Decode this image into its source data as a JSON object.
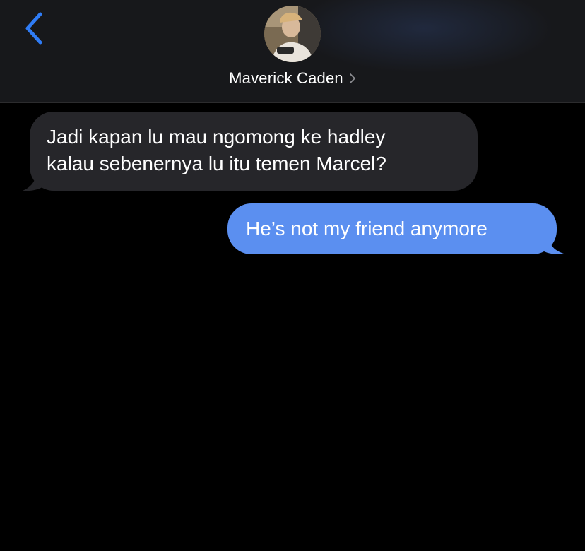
{
  "header": {
    "back_icon": "chevron-left-icon",
    "contact_name": "Maverick Caden",
    "contact_chevron_icon": "chevron-right-icon",
    "accent_color": "#2f7cf6"
  },
  "messages": [
    {
      "direction": "incoming",
      "lines": [
        "Jadi kapan lu mau ngomong ke hadley",
        "kalau sebenernya lu itu temen Marcel?"
      ],
      "bubble_color": "#26262a"
    },
    {
      "direction": "outgoing",
      "lines": [
        "He’s not my friend anymore"
      ],
      "bubble_color": "#5b8ff0"
    }
  ]
}
